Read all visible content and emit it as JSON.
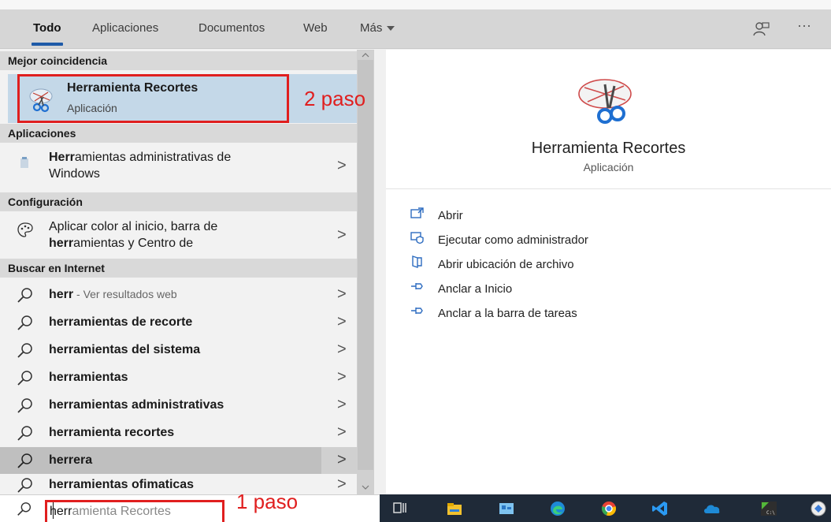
{
  "tabs": [
    {
      "label": "Todo",
      "active": true
    },
    {
      "label": "Aplicaciones"
    },
    {
      "label": "Documentos"
    },
    {
      "label": "Web"
    },
    {
      "label": "Más"
    }
  ],
  "sections": {
    "best_match": "Mejor coincidencia",
    "apps": "Aplicaciones",
    "settings": "Configuración",
    "web": "Buscar en Internet"
  },
  "best_match": {
    "title_bold": "Herr",
    "title_rest": "amienta Recortes",
    "subtitle": "Aplicación"
  },
  "apps": [
    {
      "bold": "Herr",
      "rest": "amientas administrativas de",
      "line2": "Windows"
    }
  ],
  "settings": [
    {
      "line1": "Aplicar color al inicio, barra de",
      "line2_bold": "herr",
      "line2_rest": "amientas y Centro de"
    }
  ],
  "web_results": [
    {
      "bold": "herr",
      "rest": "",
      "suffix": " - Ver resultados web"
    },
    {
      "bold": "herr",
      "rest": "amientas de recorte"
    },
    {
      "bold": "herr",
      "rest": "amientas del sistema"
    },
    {
      "bold": "herr",
      "rest": "amientas"
    },
    {
      "bold": "herr",
      "rest": "amientas administrativas"
    },
    {
      "bold": "herr",
      "rest": "amienta recortes"
    },
    {
      "bold": "herr",
      "rest": "era"
    },
    {
      "bold": "herr",
      "rest": "amientas ofimaticas"
    }
  ],
  "preview": {
    "title": "Herramienta Recortes",
    "subtitle": "Aplicación",
    "actions": [
      {
        "label": "Abrir",
        "icon": "open-icon"
      },
      {
        "label": "Ejecutar como administrador",
        "icon": "shield-icon"
      },
      {
        "label": "Abrir ubicación de archivo",
        "icon": "folder-icon"
      },
      {
        "label": "Anclar a Inicio",
        "icon": "pin-icon"
      },
      {
        "label": "Anclar a la barra de tareas",
        "icon": "pin-icon"
      }
    ]
  },
  "search": {
    "typed": "herr",
    "suggestion": "amienta Recortes"
  },
  "annotations": {
    "step1": "1 paso",
    "step2": "2 paso"
  },
  "topbar_more": "···",
  "chevron": ">"
}
